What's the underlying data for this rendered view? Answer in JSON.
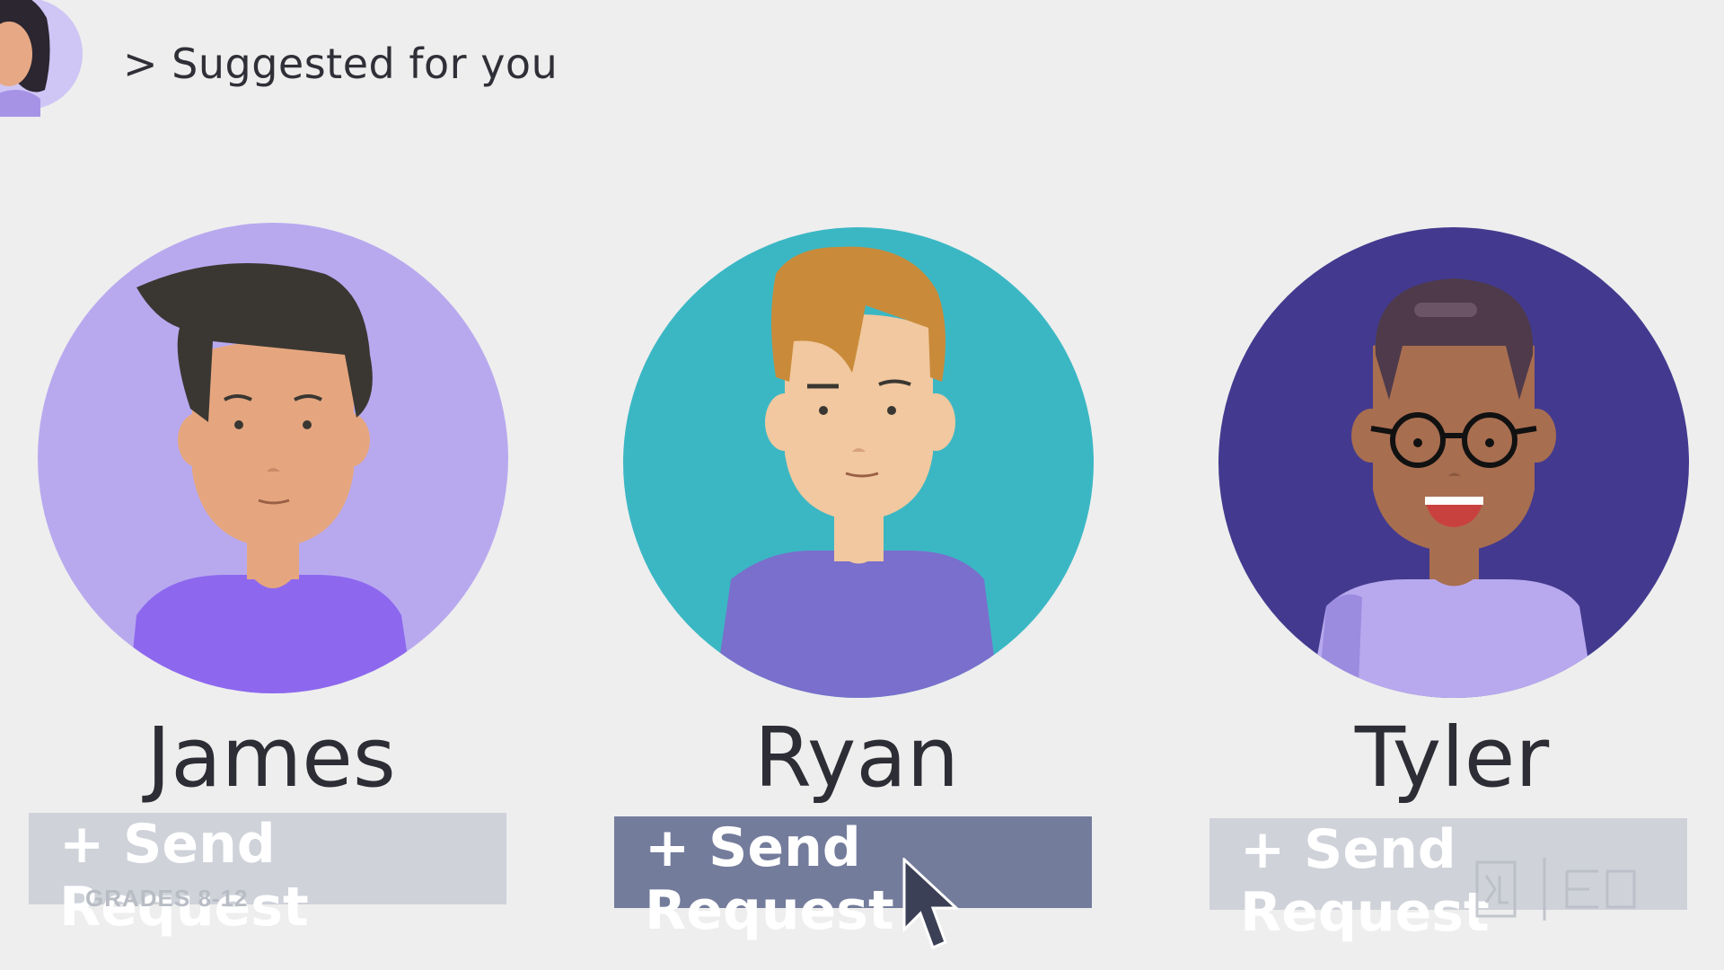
{
  "header": {
    "title": "> Suggested for you"
  },
  "suggestions": [
    {
      "name": "James",
      "button_label": "+ Send Request",
      "avatar_bg": "#b8a9ef",
      "state": "default"
    },
    {
      "name": "Ryan",
      "button_label": "+ Send Request",
      "avatar_bg": "#3bb7c4",
      "state": "hover"
    },
    {
      "name": "Tyler",
      "button_label": "+ Send Request",
      "avatar_bg": "#433a8f",
      "state": "default"
    }
  ],
  "overlay": {
    "grades": "GRADES 8-12"
  },
  "colors": {
    "button_dim": "#cfd2d9",
    "button_active": "#747c9c",
    "background": "#eeeeee"
  }
}
